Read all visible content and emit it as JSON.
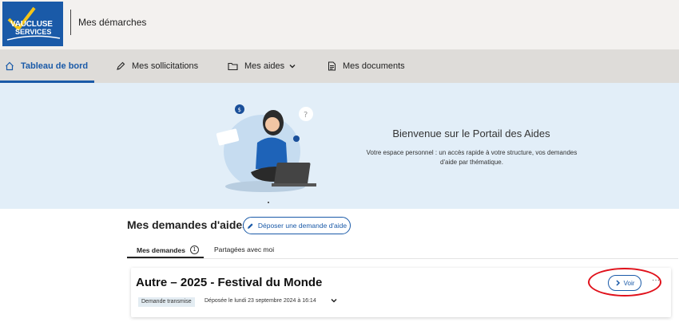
{
  "header": {
    "logo_line1": "VAUCLUSE",
    "logo_line2": "SERVICES",
    "title": "Mes démarches"
  },
  "nav": {
    "items": [
      {
        "label": "Tableau de bord",
        "icon": "home-icon",
        "active": true
      },
      {
        "label": "Mes sollicitations",
        "icon": "pen-icon"
      },
      {
        "label": "Mes aides",
        "icon": "folder-icon",
        "dropdown": true
      },
      {
        "label": "Mes documents",
        "icon": "document-icon"
      }
    ]
  },
  "banner": {
    "title": "Bienvenue sur le Portail des Aides",
    "text": "Votre espace personnel : un accès rapide à votre structure, vos demandes d'aide par thématique."
  },
  "demandes": {
    "title": "Mes demandes d'aides",
    "deposit_label": "Déposer une demande d'aide",
    "tabs": [
      {
        "label": "Mes demandes",
        "count": "1",
        "active": true
      },
      {
        "label": "Partagées avec moi"
      }
    ],
    "card": {
      "title": "Autre – 2025 - Festival du Monde",
      "status": "Demande transmise",
      "date": "Déposée le lundi 23 septembre 2024 à 16:14",
      "voir_label": "Voir",
      "more_label": "···"
    }
  },
  "colors": {
    "accent": "#1a5aa8",
    "banner_bg": "#e2eef8",
    "highlight": "#e0101a"
  }
}
